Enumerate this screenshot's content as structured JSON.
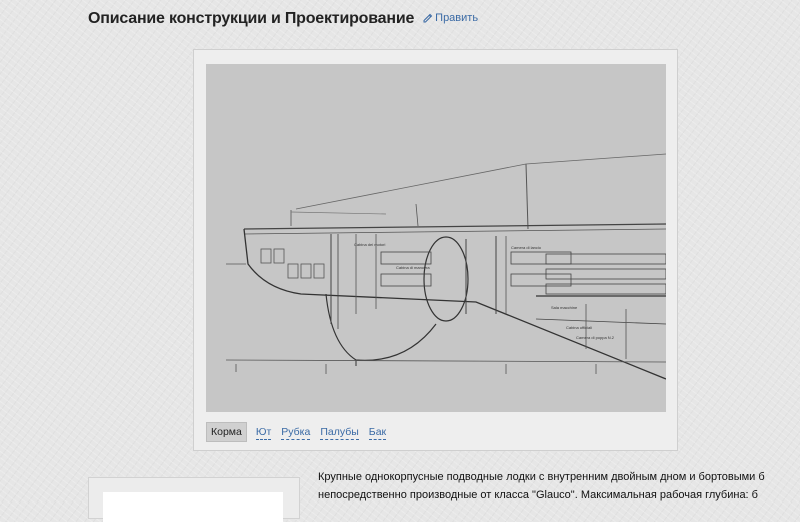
{
  "section": {
    "title": "Описание конструкции и Проектирование",
    "edit_label": "Править"
  },
  "gallery": {
    "tabs": [
      "Корма",
      "Ют",
      "Рубка",
      "Палубы",
      "Бак"
    ],
    "active_tab": "Корма",
    "drawing_labels": [
      "Cabina dei motori",
      "Cabina di manovra",
      "Camera di lancio",
      "Sala macchine",
      "Cabina ufficiali",
      "Camera di poppa N.2"
    ]
  },
  "description": {
    "line1": "Крупные однокорпусные подводные лодки с внутренним двойным дном и бортовыми б",
    "line2": "непосредственно производные от класса \"Glauco\". Максимальная рабочая глубина: б"
  }
}
